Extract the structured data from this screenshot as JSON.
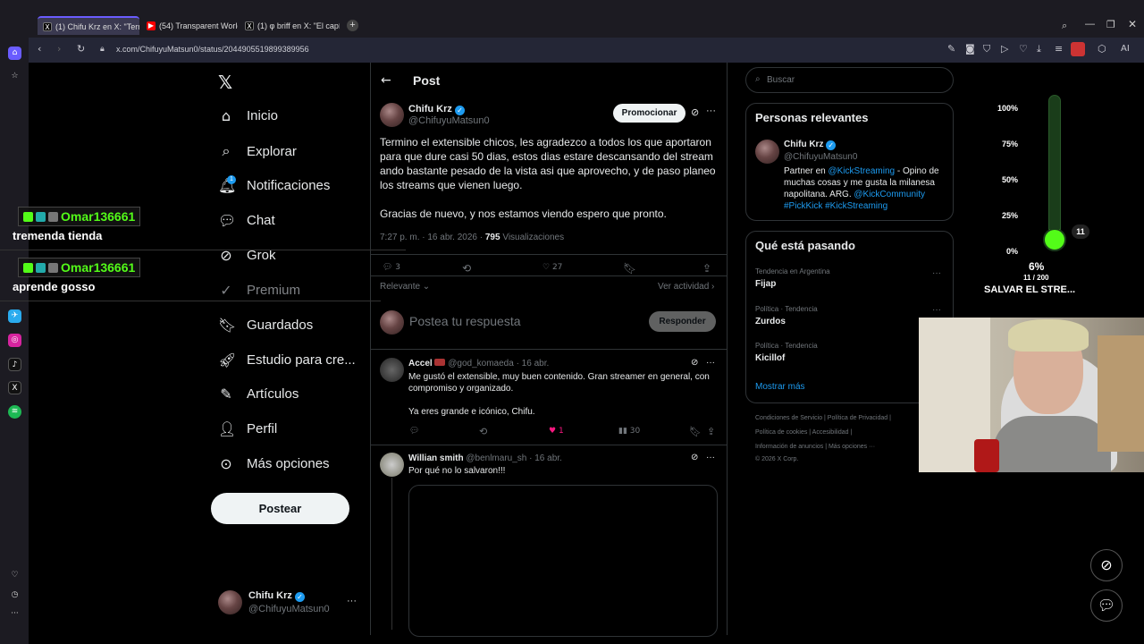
{
  "browser": {
    "tabs": [
      {
        "label": "(1) Chifu Krz en X: \"Termin"
      },
      {
        "label": "(54) Transparent World – A"
      },
      {
        "label": "(1) φ briff en X: \"El capítul"
      }
    ],
    "url": "x.com/ChifuyuMatsun0/status/2044905519899389956",
    "ext_label": "AI"
  },
  "nav": {
    "home": "Inicio",
    "explore": "Explorar",
    "notifications": "Notificaciones",
    "notif_count": "1",
    "chat": "Chat",
    "grok": "Grok",
    "premium": "Premium",
    "saved": "Guardados",
    "studio": "Estudio para cre...",
    "articles": "Artículos",
    "profile": "Perfil",
    "more": "Más opciones",
    "post_button": "Postear"
  },
  "account": {
    "name": "Chifu Krz",
    "handle": "@ChifuyuMatsun0"
  },
  "post": {
    "header": "Post",
    "author": "Chifu Krz",
    "handle": "@ChifuyuMatsun0",
    "promote": "Promocionar",
    "line1": "Termino el extensible chicos, les agradezco a todos los que aportaron",
    "line2": "para que dure casi 50 dias, estos dias estare descansando del stream",
    "line3": "ando bastante pesado de la vista asi que aprovecho, y de paso planeo",
    "line4": "los streams que vienen luego.",
    "line5": "Gracias de nuevo, y nos estamos viendo espero que pronto.",
    "time": "7:27 p. m. · 16 abr. 2026 ·",
    "views": "795",
    "views_label": "Visualizaciones",
    "replies": "3",
    "likes": "27",
    "sort": "Relevante",
    "activity": "Ver actividad",
    "reply_placeholder": "Postea tu respuesta",
    "reply_button": "Responder"
  },
  "replies": [
    {
      "name": "Accel",
      "handle": "@god_komaeda · 16 abr.",
      "line1": "Me gustó el extensible, muy buen contenido. Gran streamer en general, con",
      "line2": "compromiso y organizado.",
      "line3": "Ya eres grande e icónico, Chifu.",
      "likes": "1",
      "views": "30"
    },
    {
      "name": "Willian smith",
      "handle": "@benlmaru_sh · 16 abr.",
      "line1": "Por qué no lo salvaron!!!"
    }
  ],
  "right": {
    "search_placeholder": "Buscar",
    "relevant_title": "Personas relevantes",
    "rel_name": "Chifu Krz",
    "rel_handle": "@ChifuyuMatsun0",
    "bio1a": "Partner en ",
    "bio1b": "@KickStreaming",
    "bio1c": " - Opino de",
    "bio2": "muchas cosas y me gusta la milanesa",
    "bio3a": "napolitana. ARG. ",
    "bio3b": "@KickCommunity",
    "bio4": "#PickKick #KickStreaming",
    "trending_title": "Qué está pasando",
    "trends": [
      {
        "ctx": "Tendencia en Argentina",
        "name": "Fijap"
      },
      {
        "ctx": "Política · Tendencia",
        "name": "Zurdos"
      },
      {
        "ctx": "Política · Tendencia",
        "name": "Kicillof"
      }
    ],
    "show_more": "Mostrar más",
    "footer1": "Condiciones de Servicio  |  Política de Privacidad  |",
    "footer2": "Política de cookies  |  Accesibilidad  |",
    "footer3": "Información de anuncios  |  Más opciones ···",
    "footer4": "© 2026 X Corp."
  },
  "overlay": {
    "chat": [
      {
        "user": "Omar136661",
        "msg": "tremenda tienda"
      },
      {
        "user": "Omar136661",
        "msg": "aprende gosso"
      }
    ],
    "goal_labels": [
      "100%",
      "75%",
      "50%",
      "25%",
      "0%"
    ],
    "goal_count": "11",
    "goal_percent": "6%",
    "goal_ratio": "11 / 200",
    "goal_title": "SALVAR EL STRE...",
    "goal_fill": 0.06
  },
  "colors": {
    "accent": "#1d9bf0",
    "kick": "#53fc18",
    "like": "#f91880"
  }
}
